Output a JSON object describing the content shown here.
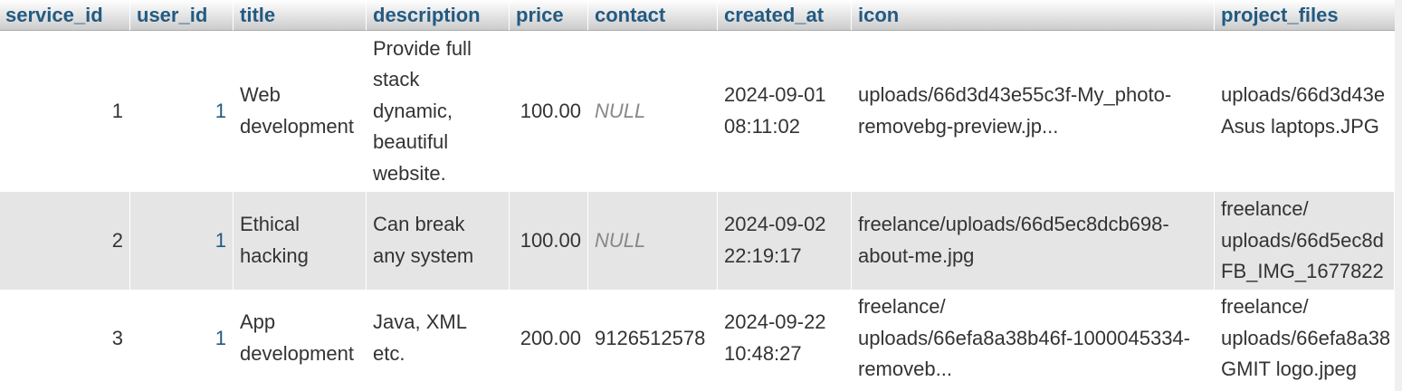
{
  "columns": [
    {
      "key": "service_id",
      "label": "service_id"
    },
    {
      "key": "user_id",
      "label": "user_id"
    },
    {
      "key": "title",
      "label": "title"
    },
    {
      "key": "description",
      "label": "description"
    },
    {
      "key": "price",
      "label": "price"
    },
    {
      "key": "contact",
      "label": "contact"
    },
    {
      "key": "created_at",
      "label": "created_at"
    },
    {
      "key": "icon",
      "label": "icon"
    },
    {
      "key": "project_files",
      "label": "project_files"
    }
  ],
  "rows": [
    {
      "service_id": "1",
      "user_id": "1",
      "title": "Web development",
      "description": "Provide full stack dynamic, beautiful website.",
      "price": "100.00",
      "contact": "NULL",
      "created_at": "2024-09-01 08:11:02",
      "icon": "uploads/66d3d43e55c3f-My_photo-removebg-preview.jp...",
      "project_files_l1": "uploads/66d3d43e",
      "project_files_l2": "Asus laptops.JPG"
    },
    {
      "service_id": "2",
      "user_id": "1",
      "title": "Ethical hacking",
      "description": "Can break any system",
      "price": "100.00",
      "contact": "NULL",
      "created_at": "2024-09-02 22:19:17",
      "icon": "freelance/uploads/66d5ec8dcb698-about-me.jpg",
      "project_files_l1": "freelance/",
      "project_files_l2": "uploads/66d5ec8d",
      "project_files_l3": "FB_IMG_1677822"
    },
    {
      "service_id": "3",
      "user_id": "1",
      "title": "App development",
      "description": "Java, XML etc.",
      "price": "200.00",
      "contact": "9126512578",
      "created_at": "2024-09-22 10:48:27",
      "icon_l1": "freelance/",
      "icon_l2": "uploads/66efa8a38b46f-1000045334-",
      "icon_l3": "removeb...",
      "project_files_l1": "freelance/",
      "project_files_l2": "uploads/66efa8a38",
      "project_files_l3": "GMIT logo.jpeg"
    }
  ],
  "colors": {
    "header_text": "#235a81",
    "row_alt": "#e5e5e5",
    "null_text": "#888888"
  }
}
